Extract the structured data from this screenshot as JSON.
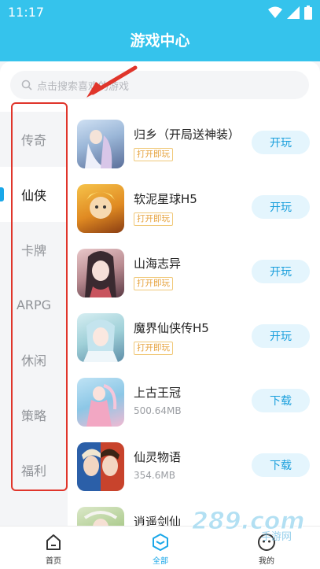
{
  "status": {
    "time": "11:17"
  },
  "header": {
    "title": "游戏中心"
  },
  "search": {
    "placeholder": "点击搜索喜欢的游戏"
  },
  "sidebar": {
    "items": [
      {
        "label": "传奇"
      },
      {
        "label": "仙侠"
      },
      {
        "label": "卡牌"
      },
      {
        "label": "ARPG"
      },
      {
        "label": "休闲"
      },
      {
        "label": "策略"
      },
      {
        "label": "福利"
      }
    ]
  },
  "games": [
    {
      "name": "归乡（开局送神装）",
      "tag": "打开即玩",
      "button": "开玩"
    },
    {
      "name": "软泥星球H5",
      "tag": "打开即玩",
      "button": "开玩"
    },
    {
      "name": "山海志异",
      "tag": "打开即玩",
      "button": "开玩"
    },
    {
      "name": "魔界仙侠传H5",
      "tag": "打开即玩",
      "button": "开玩"
    },
    {
      "name": "上古王冠",
      "size": "500.64MB",
      "button": "下载"
    },
    {
      "name": "仙灵物语",
      "size": "354.6MB",
      "button": "下载"
    },
    {
      "name": "逍遥剑仙"
    }
  ],
  "tabbar": {
    "items": [
      {
        "label": "首页"
      },
      {
        "label": "全部"
      },
      {
        "label": "我的"
      }
    ]
  },
  "watermark": {
    "text": "289.com",
    "sub": "手游网"
  },
  "colors": {
    "accent": "#35c3ec",
    "highlight": "#e0352b",
    "button_text": "#1a9fdc"
  }
}
